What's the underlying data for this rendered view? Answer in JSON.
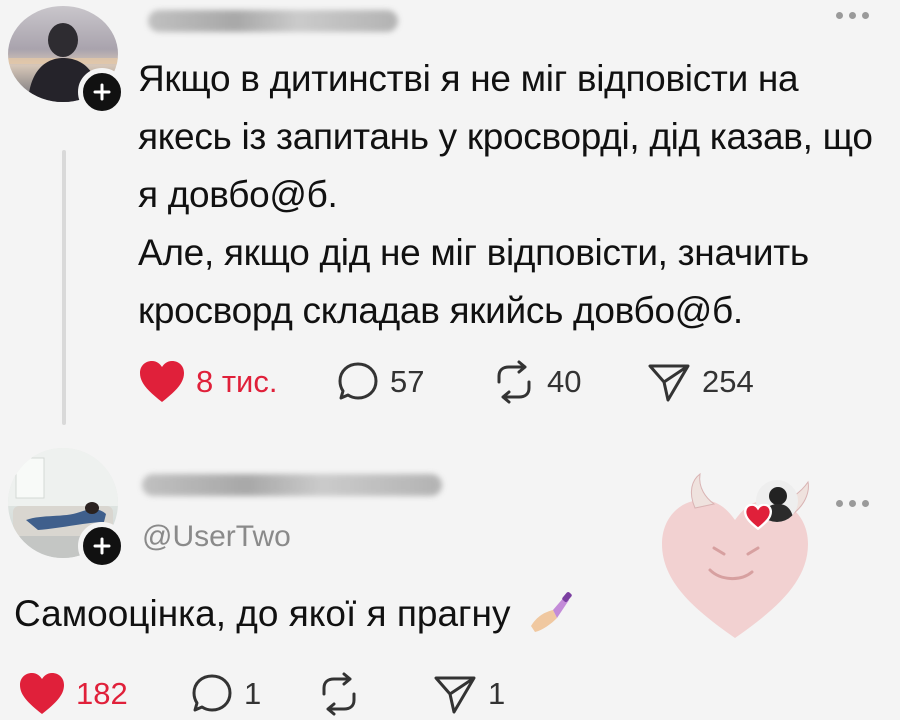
{
  "post1": {
    "author_avatar_icon": "user-avatar-silhouette",
    "follow_icon": "plus-icon",
    "more_icon": "more-dots-icon",
    "text_lines": [
      "Якщо в дитинстві я не міг відповісти на якесь із запитань у кросворді, дід казав, що я довбо@б.",
      "Але, якщо дід не міг відповісти, значить кросворд складав якийсь довбо@б."
    ],
    "likes": "8 тис.",
    "comments": "57",
    "reposts": "40",
    "shares": "254",
    "like_color": "#e0203a"
  },
  "post2": {
    "handle": "@UserTwo",
    "text": "Самооцінка, до якої я прагну",
    "emoji_icon": "nail-polish-icon",
    "likes": "182",
    "comments": "1",
    "reposts": "",
    "shares": "1",
    "like_color": "#e0203a"
  }
}
